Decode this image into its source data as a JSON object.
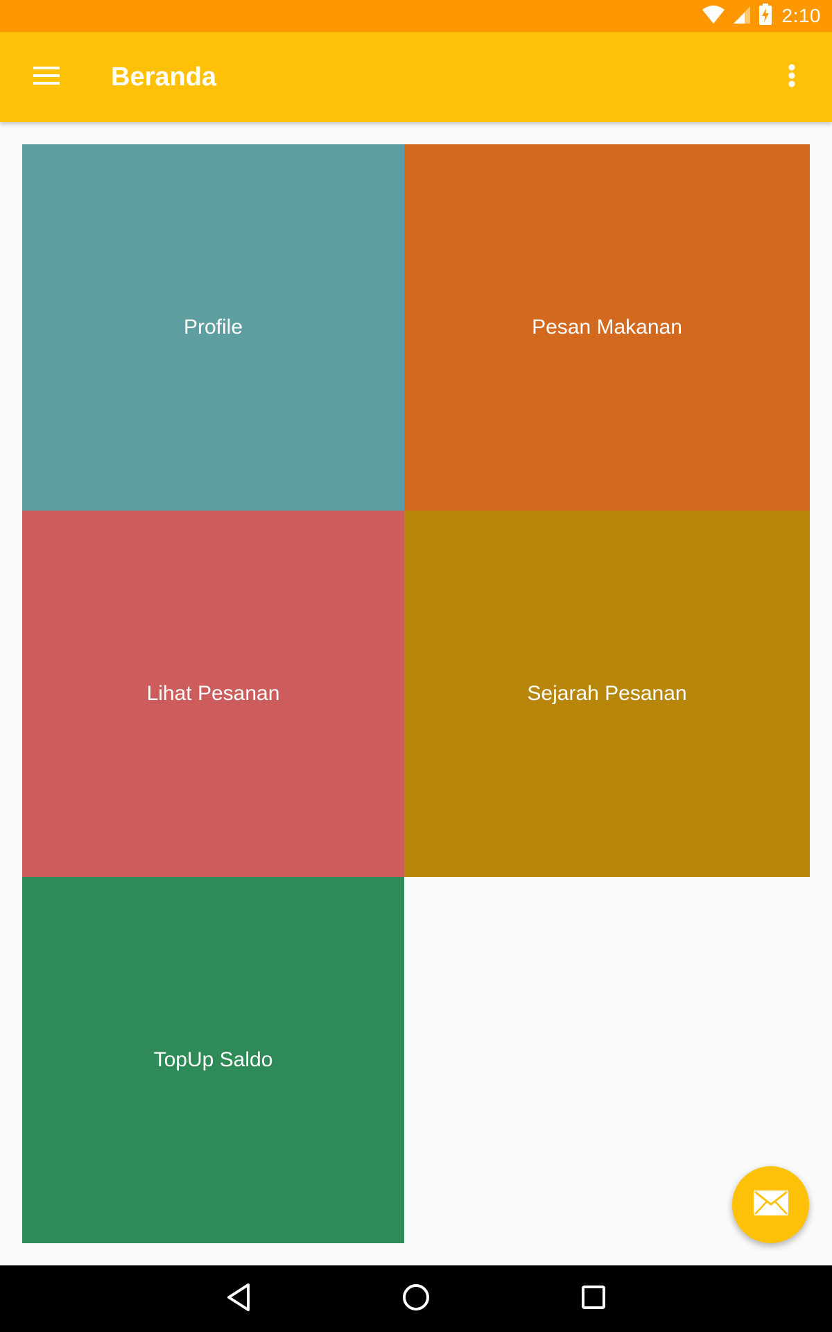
{
  "status_bar": {
    "time": "2:10",
    "icons": [
      "wifi-icon",
      "signal-icon",
      "battery-charging-icon"
    ],
    "color": "#FF9800"
  },
  "app_bar": {
    "title": "Beranda",
    "menu_icon": "hamburger-menu-icon",
    "overflow_icon": "more-vert-icon",
    "color": "#FFC107"
  },
  "tiles": [
    {
      "label": "Profile",
      "color": "#5F9EA0"
    },
    {
      "label": "Pesan Makanan",
      "color": "#D2691E"
    },
    {
      "label": "Lihat Pesanan",
      "color": "#CD5C5C"
    },
    {
      "label": "Sejarah Pesanan",
      "color": "#B8860B"
    },
    {
      "label": "TopUp Saldo",
      "color": "#2E8B57"
    }
  ],
  "fab": {
    "icon": "mail-icon",
    "color": "#FFC107"
  },
  "nav_bar": {
    "icons": [
      "back-icon",
      "home-icon",
      "recents-icon"
    ]
  }
}
